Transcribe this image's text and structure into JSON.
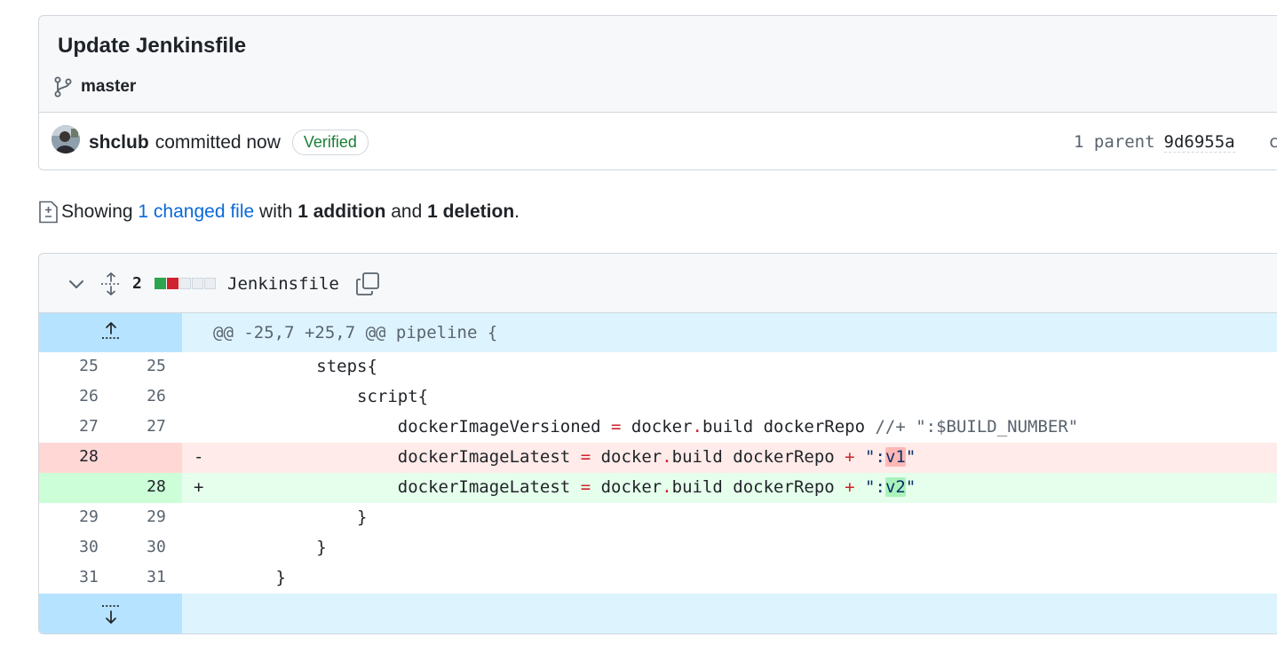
{
  "commit": {
    "title": "Update Jenkinsfile",
    "branch": "master",
    "author": "shclub",
    "action": "committed now",
    "badge": "Verified",
    "parent_label": "1 parent",
    "parent_sha": "9d6955a",
    "parent_more": "c"
  },
  "summary": {
    "prefix": "Showing",
    "changed_files": "1 changed file",
    "with": "with",
    "additions": "1 addition",
    "and": "and",
    "deletions": "1 deletion",
    "suffix": "."
  },
  "file": {
    "changes": "2",
    "name": "Jenkinsfile",
    "hunk_header": "@@ -25,7 +25,7 @@ pipeline {",
    "lines": [
      {
        "old": "25",
        "new": "25",
        "sign": "",
        "text": "            steps{"
      },
      {
        "old": "26",
        "new": "26",
        "sign": "",
        "text": "                script{"
      },
      {
        "old": "27",
        "new": "27",
        "sign": "",
        "text": "                    dockerImageVersioned = docker.build dockerRepo //+ \":$BUILD_NUMBER\""
      },
      {
        "old": "28",
        "new": "",
        "sign": "-",
        "text": "                    dockerImageLatest = docker.build dockerRepo + \":v1\""
      },
      {
        "old": "",
        "new": "28",
        "sign": "+",
        "text": "                    dockerImageLatest = docker.build dockerRepo + \":v2\""
      },
      {
        "old": "29",
        "new": "29",
        "sign": "",
        "text": "                }"
      },
      {
        "old": "30",
        "new": "30",
        "sign": "",
        "text": "            }"
      },
      {
        "old": "31",
        "new": "31",
        "sign": "",
        "text": "        }"
      }
    ]
  },
  "colors": {
    "addition": "#2da44e",
    "deletion": "#cf222e",
    "link": "#0969da",
    "verified": "#1a7f37"
  },
  "icons": [
    "git-branch-icon",
    "file-diff-icon",
    "chevron-down-icon",
    "unfold-icon",
    "copy-icon",
    "expand-up-icon",
    "expand-down-icon"
  ]
}
